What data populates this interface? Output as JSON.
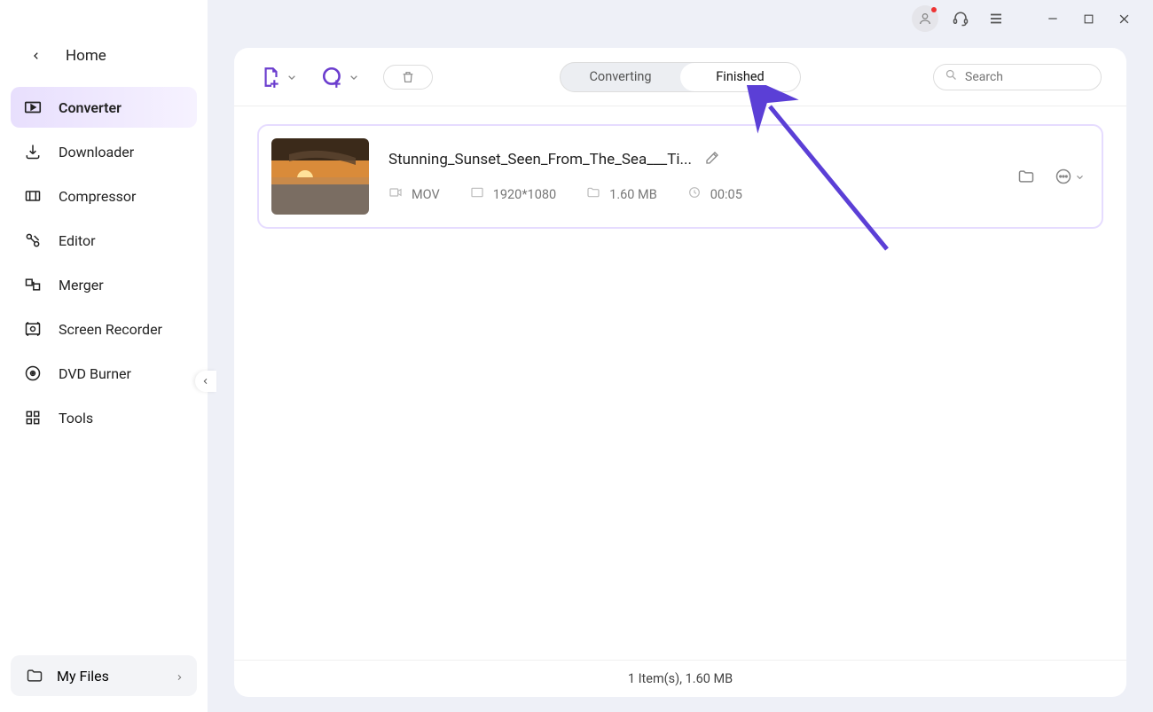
{
  "window": {
    "avatar_tooltip": "Account",
    "headset_tooltip": "Support",
    "menu_tooltip": "Menu",
    "minimize_tooltip": "Minimize",
    "maximize_tooltip": "Maximize",
    "close_tooltip": "Close"
  },
  "sidebar": {
    "home_label": "Home",
    "items": [
      {
        "label": "Converter",
        "icon": "converter"
      },
      {
        "label": "Downloader",
        "icon": "downloader"
      },
      {
        "label": "Compressor",
        "icon": "compressor"
      },
      {
        "label": "Editor",
        "icon": "editor"
      },
      {
        "label": "Merger",
        "icon": "merger"
      },
      {
        "label": "Screen Recorder",
        "icon": "screen-recorder"
      },
      {
        "label": "DVD Burner",
        "icon": "dvd-burner"
      },
      {
        "label": "Tools",
        "icon": "tools"
      }
    ],
    "myfiles_label": "My Files"
  },
  "toolbar": {
    "add_file_tooltip": "Add File",
    "add_url_tooltip": "Add from URL",
    "trash_tooltip": "Clear",
    "tab_converting": "Converting",
    "tab_finished": "Finished",
    "search_placeholder": "Search"
  },
  "file": {
    "title": "Stunning_Sunset_Seen_From_The_Sea___Ti...",
    "format": "MOV",
    "resolution": "1920*1080",
    "size": "1.60 MB",
    "duration": "00:05"
  },
  "statusbar": {
    "text": "1 Item(s), 1.60 MB"
  }
}
